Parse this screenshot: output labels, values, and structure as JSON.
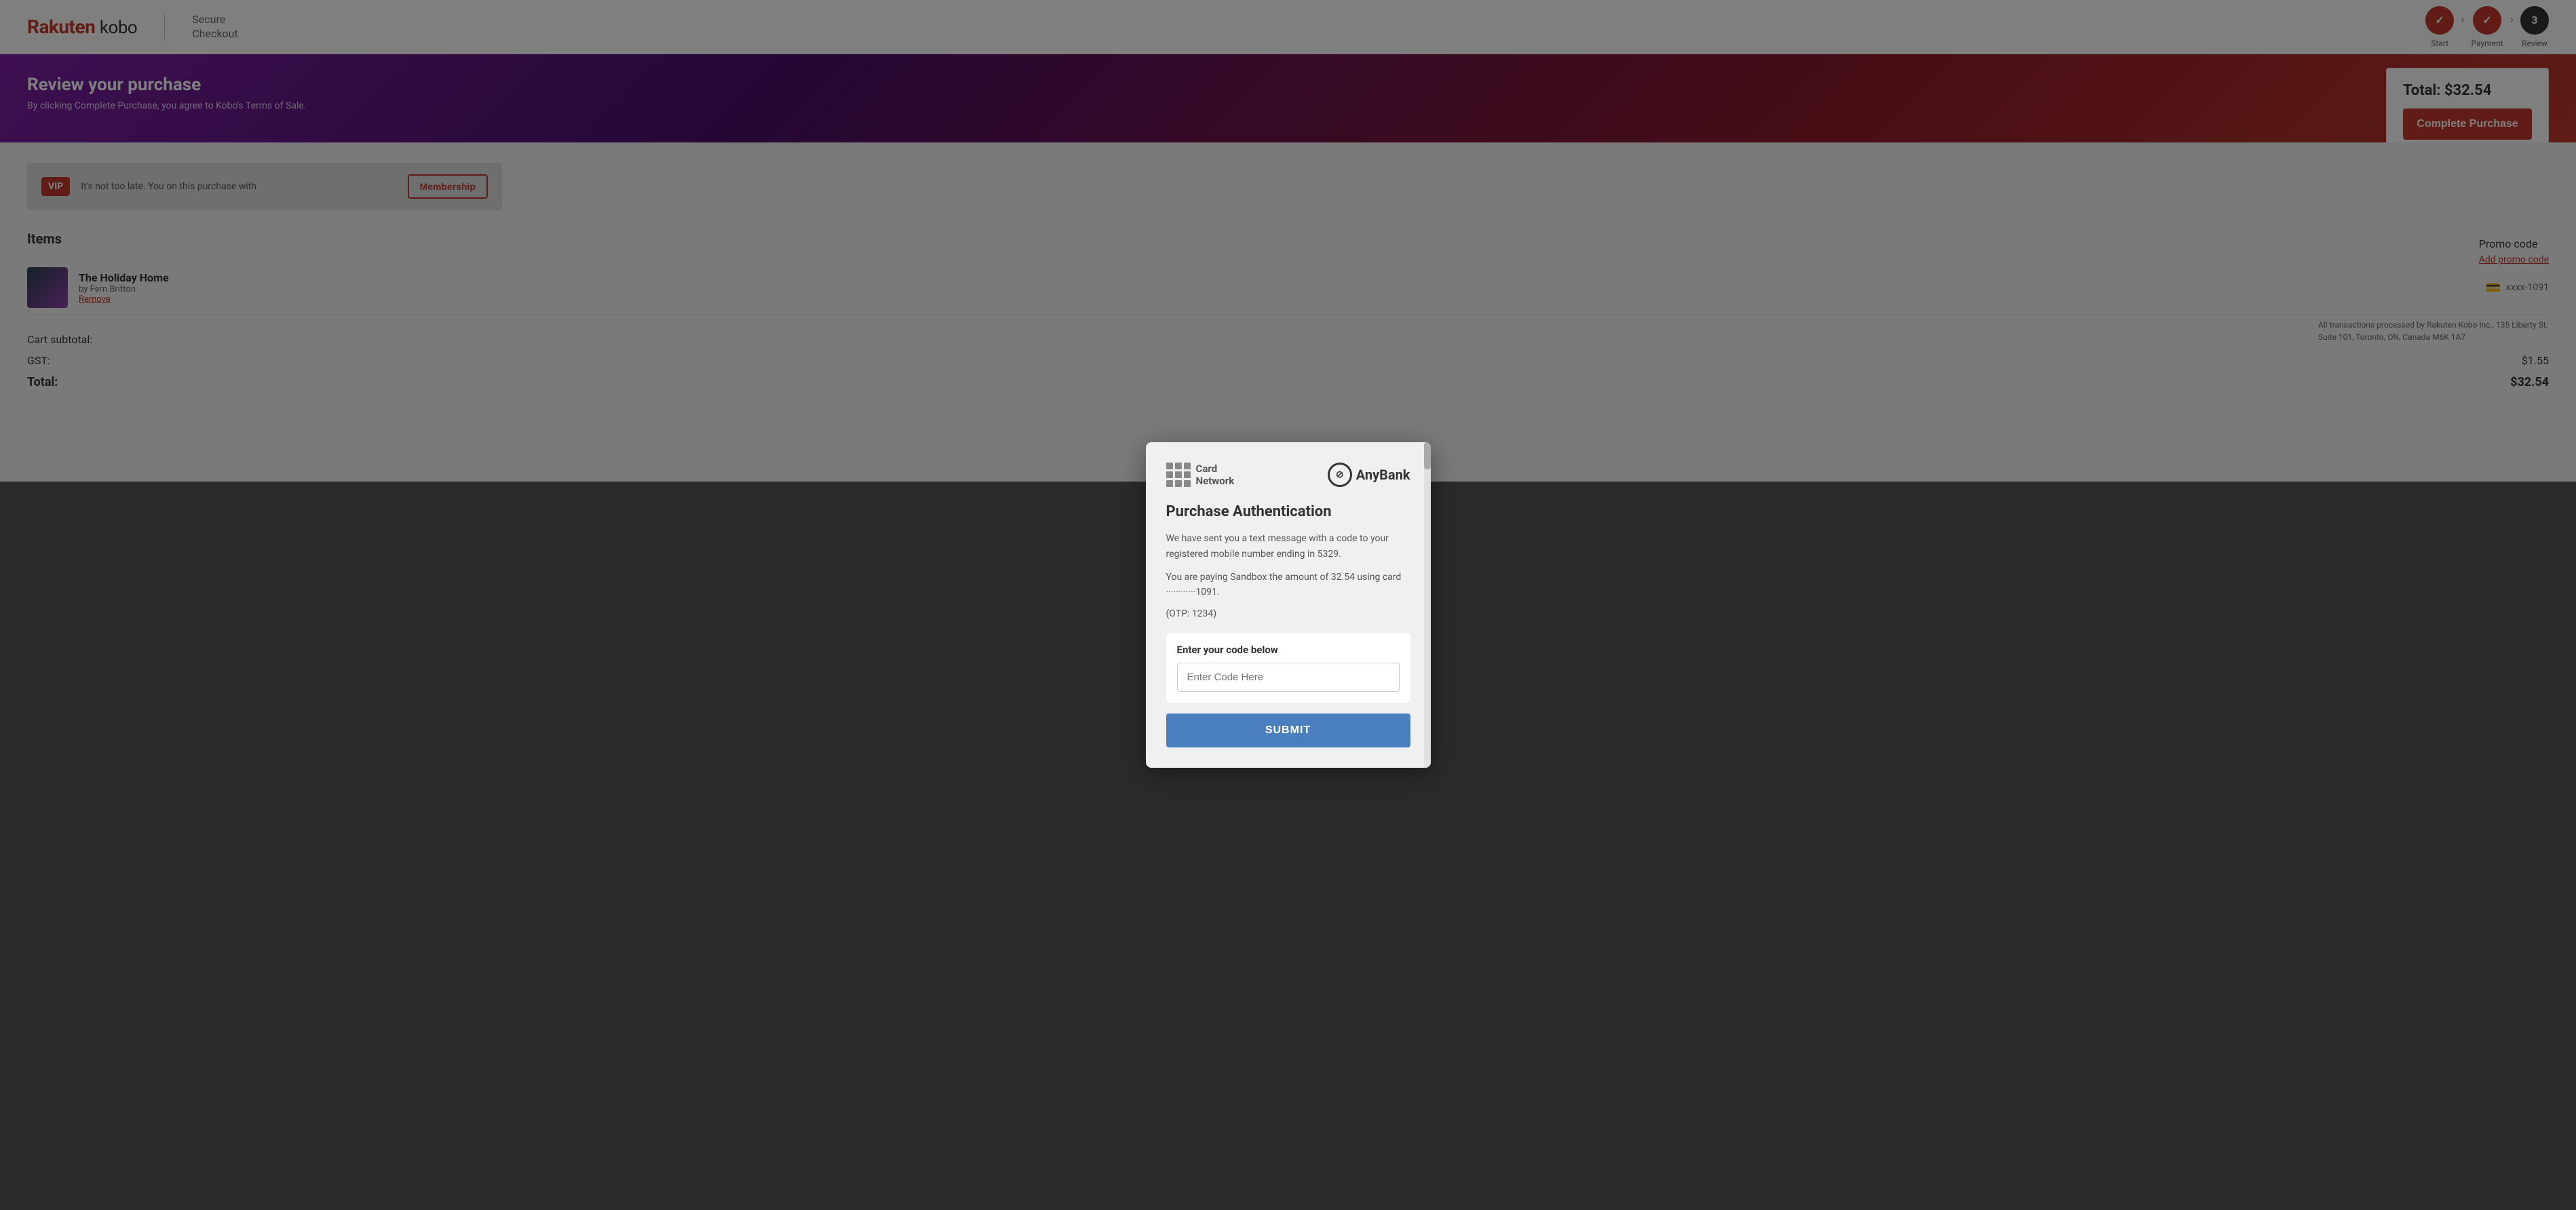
{
  "header": {
    "logo": "Rakuten kobo",
    "logo_part1": "Rakuten",
    "logo_part2": "kobo",
    "secure_checkout_line1": "Secure",
    "secure_checkout_line2": "Checkout",
    "steps": [
      {
        "label": "Start",
        "state": "done",
        "number": "✓"
      },
      {
        "label": "Payment",
        "state": "done",
        "number": "✓"
      },
      {
        "label": "Review",
        "state": "active",
        "number": "3"
      }
    ]
  },
  "hero": {
    "title": "Review your purchase",
    "subtitle": "By clicking Complete Purchase, you agree to Kobo's Terms of Sale.",
    "total_label": "Total:",
    "total_amount": "$32.54",
    "complete_button": "Complete Purchase"
  },
  "vip": {
    "badge": "VIP",
    "text": "It's not too late. You",
    "text_suffix": "on this purchase with",
    "membership_button": "Membership"
  },
  "items_section": {
    "title": "Items",
    "items": [
      {
        "title": "The Holiday Home",
        "author": "by Fern Britton",
        "remove_label": "Remove",
        "card_info": "xxxx-1091"
      }
    ]
  },
  "cart": {
    "subtotal_label": "Cart subtotal:",
    "subtotal_value": "",
    "gst_label": "GST:",
    "gst_value": "$1.55",
    "total_label": "Total:",
    "total_value": "$32.54"
  },
  "promo": {
    "title": "Promo code",
    "add_link": "Add promo code"
  },
  "transaction_info": "All transactions processed by Rakuten Kobo Inc., 135 Liberty St. Suite 101, Toronto, ON, Canada M6K 1A7",
  "modal": {
    "card_network_label_line1": "Card",
    "card_network_label_line2": "Network",
    "anybank_label": "AnyBank",
    "title": "Purchase Authentication",
    "desc1": "We have sent you a text message with a code to your registered mobile number ending in 5329.",
    "desc2": "You are paying Sandbox the amount of 32.54 using card ············1091.",
    "otp_hint": "(OTP: 1234)",
    "code_section_label": "Enter your code below",
    "code_input_placeholder": "Enter Code Here",
    "submit_button": "SUBMIT"
  }
}
